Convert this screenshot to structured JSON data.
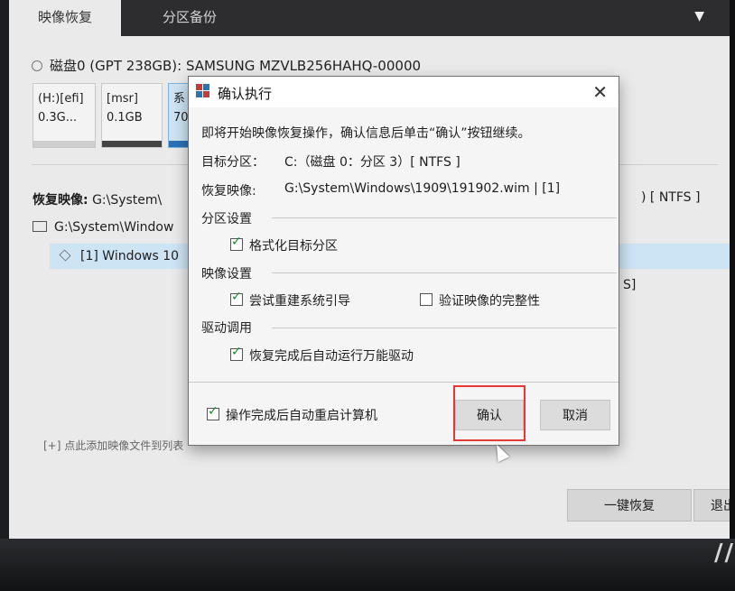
{
  "tabs": [
    {
      "label": "映像恢复"
    },
    {
      "label": "分区备份"
    }
  ],
  "disk_label": "磁盘0 (GPT 238GB): SAMSUNG MZVLB256HAHQ-00000",
  "partitions": [
    {
      "name": "(H:)[efi]",
      "size": "0.3G..."
    },
    {
      "name": "[msr]",
      "size": "0.1GB"
    },
    {
      "name": "系",
      "size": "70"
    }
  ],
  "restore_image_label": "恢复映像:",
  "restore_image_value": "G:\\System\\",
  "ntfs_tail": ") [ NTFS ]",
  "tree_item_1": "G:\\System\\Window",
  "tree_item_2": "[1] Windows 10",
  "s_tail": "S]",
  "add_image_link": "[+] 点此添加映像文件到列表",
  "bottom_buttons": {
    "one_key_restore": "一键恢复",
    "exit": "退出"
  },
  "dialog": {
    "title": "确认执行",
    "intro": "即将开始映像恢复操作，确认信息后单击“确认”按钮继续。",
    "target_label": "目标分区：",
    "target_value": "C:（磁盘 0：分区 3）[ NTFS ]",
    "image_label": "恢复映像:",
    "image_value": "G:\\System\\Windows\\1909\\191902.wim | [1]",
    "groups": {
      "partition": "分区设置",
      "image": "映像设置",
      "driver": "驱动调用"
    },
    "options": {
      "format_target": {
        "label": "格式化目标分区",
        "checked": true
      },
      "rebuild_boot": {
        "label": "尝试重建系统引导",
        "checked": true
      },
      "verify_image": {
        "label": "验证映像的完整性",
        "checked": false
      },
      "auto_driver": {
        "label": "恢复完成后自动运行万能驱动",
        "checked": true
      },
      "auto_restart": {
        "label": "操作完成后自动重启计算机",
        "checked": true
      }
    },
    "confirm_label": "确认",
    "cancel_label": "取消"
  },
  "colors": {
    "accent_blue": "#2a72b8",
    "highlight_red": "#e53935",
    "check_green": "#1a8a2e"
  }
}
